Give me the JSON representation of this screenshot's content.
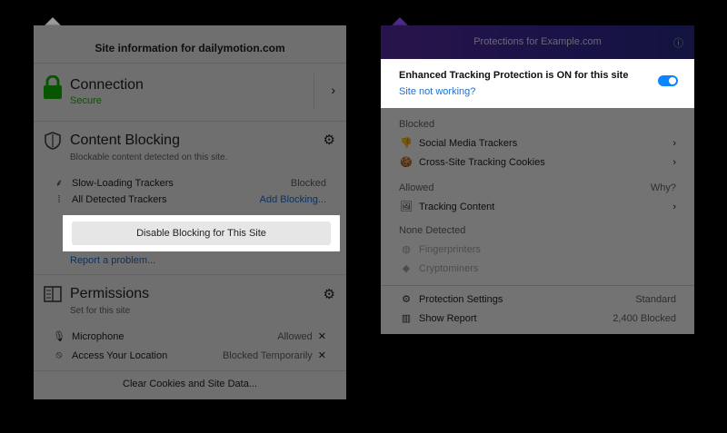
{
  "site_info": {
    "title": "Site information for dailymotion.com",
    "connection": {
      "label": "Connection",
      "status": "Secure"
    },
    "content_blocking": {
      "label": "Content Blocking",
      "subtitle": "Blockable content detected on this site.",
      "items": [
        {
          "label": "Slow-Loading Trackers",
          "value": "Blocked"
        },
        {
          "label": "All Detected Trackers",
          "value": "Add Blocking..."
        }
      ],
      "disable_button": "Disable Blocking for This Site",
      "report_link": "Report a problem..."
    },
    "permissions": {
      "label": "Permissions",
      "subtitle": "Set for this site",
      "items": [
        {
          "label": "Microphone",
          "value": "Allowed"
        },
        {
          "label": "Access Your Location",
          "value": "Blocked Temporarily"
        }
      ]
    },
    "clear_button": "Clear Cookies and Site Data..."
  },
  "protections": {
    "title": "Protections for Example.com",
    "etp_status": "Enhanced Tracking Protection is ON for this site",
    "site_not_working": "Site not working?",
    "blocked_heading": "Blocked",
    "blocked_items": [
      "Social Media Trackers",
      "Cross-Site Tracking Cookies"
    ],
    "allowed_heading": "Allowed",
    "allowed_why": "Why?",
    "allowed_items": [
      "Tracking Content"
    ],
    "none_heading": "None Detected",
    "none_items": [
      "Fingerprinters",
      "Cryptominers"
    ],
    "protection_settings": {
      "label": "Protection Settings",
      "value": "Standard"
    },
    "show_report": {
      "label": "Show Report",
      "value": "2,400 Blocked"
    }
  }
}
